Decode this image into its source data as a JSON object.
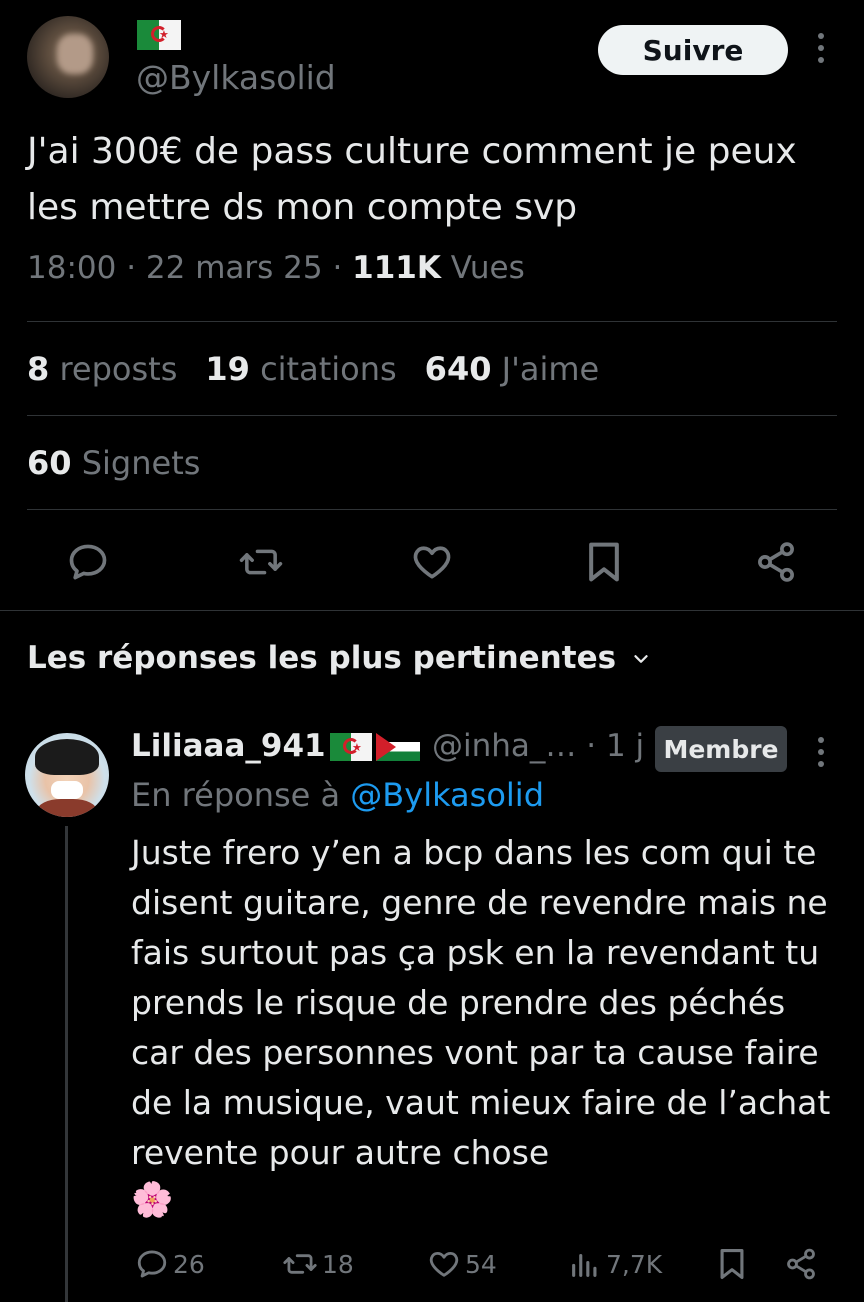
{
  "tweet": {
    "author_handle": "@Bylkasolid",
    "follow_label": "Suivre",
    "text": "J'ai 300€ de pass culture comment je peux les mettre ds mon compte svp",
    "time": "18:00",
    "sep1": " · ",
    "date": "22 mars 25",
    "sep2": " · ",
    "views_count": "111K",
    "views_label": " Vues",
    "reposts_count": "8",
    "reposts_label": " reposts",
    "quotes_count": "19",
    "quotes_label": " citations",
    "likes_count": "640",
    "likes_label": " J'aime",
    "bookmarks_count": "60",
    "bookmarks_label": " Signets",
    "actions": [
      "reply-icon",
      "repost-icon",
      "like-icon",
      "bookmark-icon",
      "share-icon"
    ]
  },
  "replies_section": {
    "title": "Les réponses les plus pertinentes"
  },
  "reply": {
    "name": "Liliaaa_941",
    "handle": "@inha_…",
    "time": " · 1 j",
    "badge": "Membre",
    "in_reply_prefix": "En réponse à ",
    "in_reply_mention": "@Bylkasolid",
    "text": "Juste frero y’en a bcp dans les com qui te disent guitare, genre de revendre mais ne fais surtout pas ça psk en la revendant tu prends le risque de prendre des péchés car des personnes vont par ta cause faire de la musique, vaut mieux faire de l’achat revente pour autre chose",
    "emoji": "🌸",
    "reply_count": "26",
    "repost_count": "18",
    "like_count": "54",
    "views_count": "7,7K"
  },
  "colors": {
    "background": "#000000",
    "text_primary": "#e7e9ea",
    "text_secondary": "#71767b",
    "link": "#1d9bf0",
    "divider": "#2f3336"
  }
}
